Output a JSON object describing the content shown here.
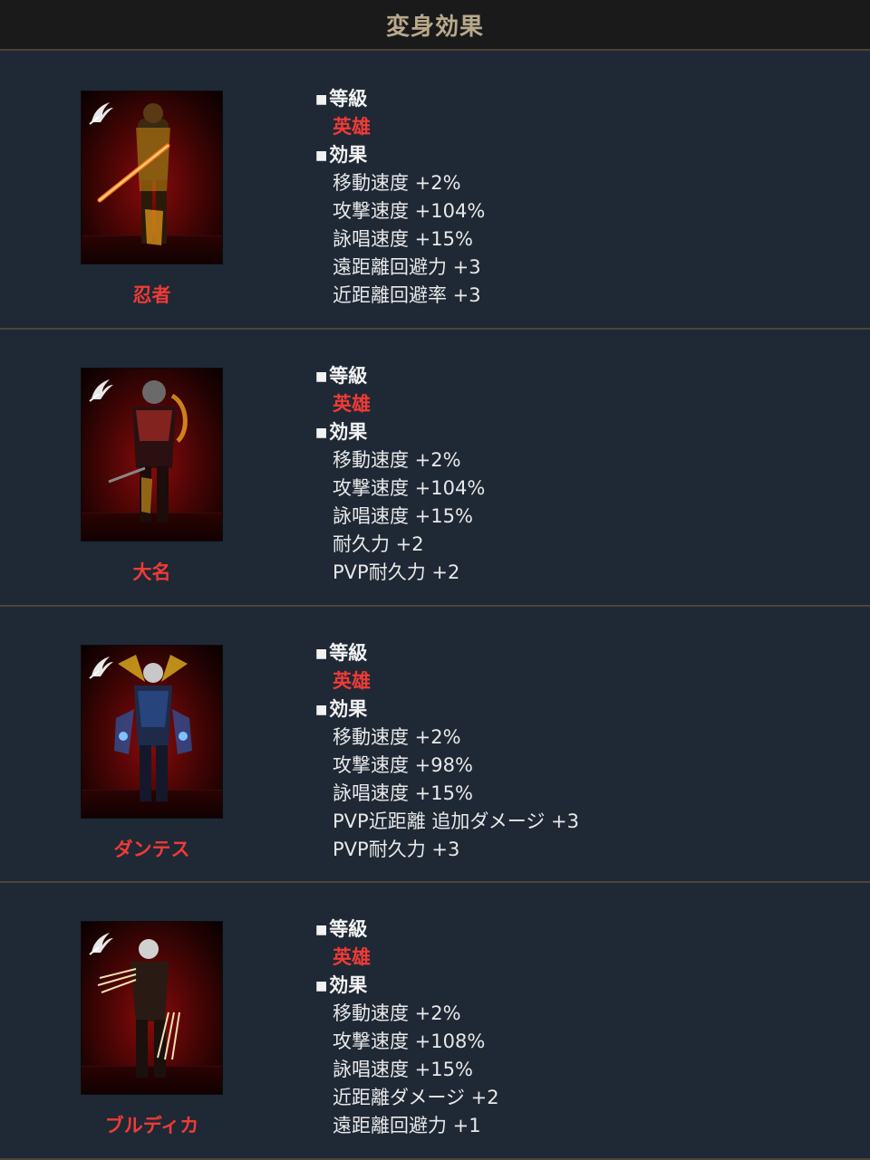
{
  "header": {
    "title": "変身効果"
  },
  "labels": {
    "grade": "等級",
    "effect": "効果",
    "bullet": "■"
  },
  "colors": {
    "rarity_red": "#ef3b36",
    "background": "#1f2835",
    "header_bg": "#1a1a1b",
    "header_text": "#b8a98a"
  },
  "transformations": [
    {
      "name": "忍者",
      "grade": "英雄",
      "icon": "wing-icon",
      "effects": [
        "移動速度 +2%",
        "攻撃速度 +104%",
        "詠唱速度 +15%",
        "遠距離回避力 +3",
        "近距離回避率 +3"
      ]
    },
    {
      "name": "大名",
      "grade": "英雄",
      "icon": "wing-icon",
      "effects": [
        "移動速度 +2%",
        "攻撃速度 +104%",
        "詠唱速度 +15%",
        "耐久力 +2",
        "PVP耐久力 +2"
      ]
    },
    {
      "name": "ダンテス",
      "grade": "英雄",
      "icon": "wing-icon",
      "effects": [
        "移動速度 +2%",
        "攻撃速度 +98%",
        "詠唱速度 +15%",
        "PVP近距離 追加ダメージ +3",
        "PVP耐久力 +3"
      ]
    },
    {
      "name": "ブルディカ",
      "grade": "英雄",
      "icon": "wing-icon",
      "effects": [
        "移動速度 +2%",
        "攻撃速度 +108%",
        "詠唱速度 +15%",
        "近距離ダメージ +2",
        "遠距離回避力 +1"
      ]
    }
  ]
}
